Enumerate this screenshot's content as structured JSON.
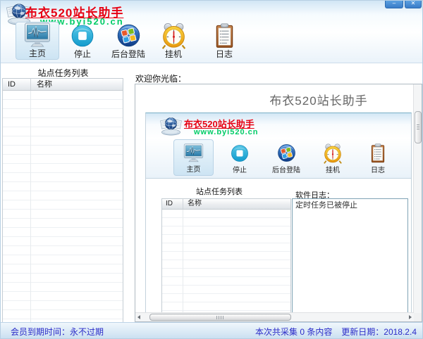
{
  "window": {
    "title": "布衣520站长助手",
    "url": "www.byi520.cn",
    "minimize_glyph": "–",
    "close_glyph": "✕"
  },
  "toolbar": {
    "items": [
      {
        "label": "主页",
        "icon": "home-monitor-icon",
        "selected": true
      },
      {
        "label": "停止",
        "icon": "stop-icon",
        "selected": false
      },
      {
        "label": "后台登陆",
        "icon": "windows-login-icon",
        "selected": false
      },
      {
        "label": "挂机",
        "icon": "alarm-clock-icon",
        "selected": false
      },
      {
        "label": "日志",
        "icon": "clipboard-log-icon",
        "selected": false
      }
    ]
  },
  "task_panel": {
    "title": "站点任务列表",
    "columns": [
      "ID",
      "名称"
    ],
    "rows": []
  },
  "welcome_panel": {
    "label": "欢迎你光临：",
    "page_heading": "布衣520站长助手"
  },
  "embedded_app": {
    "title": "布衣520站长助手",
    "url": "www.byi520.cn",
    "task_panel": {
      "title": "站点任务列表",
      "columns": [
        "ID",
        "名称"
      ],
      "rows": []
    },
    "log_panel": {
      "label": "软件日志：",
      "entries": [
        "定时任务已被停止"
      ]
    }
  },
  "status_bar": {
    "member": "会员到期时间：永不过期",
    "collected": "本次共采集 0 条内容",
    "updated": "更新日期：2018.2.4"
  },
  "colors": {
    "title_red": "#e60012",
    "url_green": "#00cc66",
    "status_blue": "#2b2bc8",
    "selected_button_fill": "#cde4f3",
    "window_control_blue": "#3a7cc8"
  }
}
